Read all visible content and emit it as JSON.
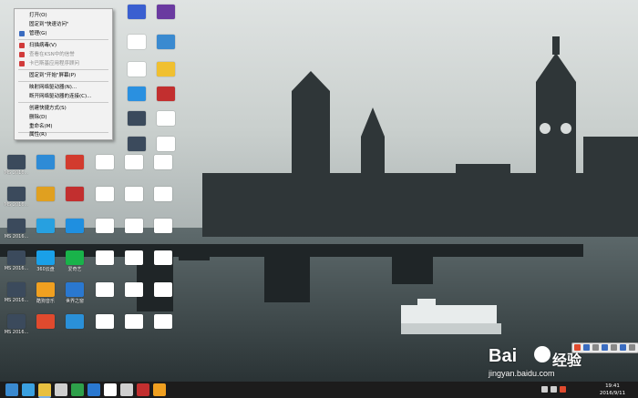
{
  "context_menu": {
    "items": [
      {
        "label": "打开(O)",
        "icon": "",
        "disabled": false
      },
      {
        "label": "固定到\"快速访问\"",
        "icon": "",
        "disabled": false
      },
      {
        "label": "管理(G)",
        "icon": "shield-icon",
        "disabled": false
      },
      {
        "label": "扫描病毒(V)",
        "icon": "antivirus-icon",
        "disabled": false
      },
      {
        "label": "查看在KSN中的信誉",
        "icon": "antivirus-icon",
        "disabled": true
      },
      {
        "label": "卡巴斯基应用程序顾问",
        "icon": "antivirus-icon",
        "disabled": true
      },
      {
        "label": "固定到\"开始\"屏幕(P)",
        "icon": "",
        "disabled": false
      },
      {
        "label": "映射网络驱动器(N)...",
        "icon": "",
        "disabled": false
      },
      {
        "label": "断开网络驱动器的连接(C)...",
        "icon": "",
        "disabled": false
      },
      {
        "label": "创建快捷方式(S)",
        "icon": "",
        "disabled": false
      },
      {
        "label": "删除(D)",
        "icon": "",
        "disabled": false
      },
      {
        "label": "重命名(M)",
        "icon": "",
        "disabled": false
      },
      {
        "label": "属性(R)",
        "icon": "",
        "disabled": false
      }
    ]
  },
  "desktop": {
    "icons": [
      {
        "caption": "MS 2016...",
        "color": "#3b4a5c"
      },
      {
        "caption": "",
        "color": "#2e8bd6"
      },
      {
        "caption": "",
        "color": "#d23b2e"
      },
      {
        "caption": "",
        "color": "#ffffff"
      },
      {
        "caption": "",
        "color": "#ffffff"
      },
      {
        "caption": "",
        "color": "#ffffff"
      },
      {
        "caption": "MS 2016...",
        "color": "#3b4a5c"
      },
      {
        "caption": "",
        "color": "#e0a020"
      },
      {
        "caption": "",
        "color": "#c22f2f"
      },
      {
        "caption": "",
        "color": "#ffffff"
      },
      {
        "caption": "",
        "color": "#ffffff"
      },
      {
        "caption": "",
        "color": "#ffffff"
      },
      {
        "caption": "MS 2016...",
        "color": "#3b4a5c"
      },
      {
        "caption": "",
        "color": "#27a0e0"
      },
      {
        "caption": "",
        "color": "#1f8fe0"
      },
      {
        "caption": "",
        "color": "#ffffff"
      },
      {
        "caption": "",
        "color": "#ffffff"
      },
      {
        "caption": "",
        "color": "#ffffff"
      },
      {
        "caption": "MS 2016...",
        "color": "#3b4a5c"
      },
      {
        "caption": "360云盘",
        "color": "#1aa0e8"
      },
      {
        "caption": "爱奇艺",
        "color": "#19b34a"
      },
      {
        "caption": "",
        "color": "#ffffff"
      },
      {
        "caption": "",
        "color": "#ffffff"
      },
      {
        "caption": "",
        "color": "#ffffff"
      },
      {
        "caption": "MS 2016...",
        "color": "#3b4a5c"
      },
      {
        "caption": "酷狗音乐",
        "color": "#f0a020"
      },
      {
        "caption": "世界之窗",
        "color": "#2a78d0"
      },
      {
        "caption": "",
        "color": "#ffffff"
      },
      {
        "caption": "",
        "color": "#ffffff"
      },
      {
        "caption": "",
        "color": "#ffffff"
      },
      {
        "caption": "MS 2016...",
        "color": "#3b4a5c"
      },
      {
        "caption": "",
        "color": "#e04a2e"
      },
      {
        "caption": "",
        "color": "#2a90d8"
      },
      {
        "caption": "",
        "color": "#ffffff"
      },
      {
        "caption": "",
        "color": "#ffffff"
      },
      {
        "caption": "",
        "color": "#ffffff"
      }
    ],
    "top_row": [
      {
        "caption": "",
        "color": "#3a5fd0"
      },
      {
        "caption": "",
        "color": "#6a3aa0"
      },
      {
        "caption": "",
        "color": "#ffffff"
      },
      {
        "caption": "",
        "color": "#3a8ad0"
      },
      {
        "caption": "",
        "color": "#ffffff"
      },
      {
        "caption": "",
        "color": "#f0c030"
      },
      {
        "caption": "",
        "color": "#2a90e0"
      },
      {
        "caption": "",
        "color": "#c22f2f"
      },
      {
        "caption": "",
        "color": "#3b4a5c"
      },
      {
        "caption": "",
        "color": "#ffffff"
      },
      {
        "caption": "",
        "color": "#3b4a5c"
      },
      {
        "caption": "",
        "color": "#ffffff"
      }
    ]
  },
  "taskbar": {
    "buttons": [
      {
        "name": "start-button",
        "color": "#3a8ad0"
      },
      {
        "name": "ie-button",
        "color": "#3aa0e0"
      },
      {
        "name": "explorer-button",
        "color": "#e8c040"
      },
      {
        "name": "app-button",
        "color": "#cfcfcf"
      },
      {
        "name": "app-button",
        "color": "#2ea04a"
      },
      {
        "name": "app-button",
        "color": "#2a78d0"
      },
      {
        "name": "app-button",
        "color": "#ffffff"
      },
      {
        "name": "app-button",
        "color": "#cfcfcf"
      },
      {
        "name": "app-button",
        "color": "#c22f2f"
      },
      {
        "name": "app-button",
        "color": "#f0a020"
      }
    ],
    "clock_time": "19:41",
    "clock_date": "2016/9/11"
  },
  "watermark": {
    "logo": "Bai",
    "logo_cn": "经验",
    "url": "jingyan.baidu.com"
  }
}
